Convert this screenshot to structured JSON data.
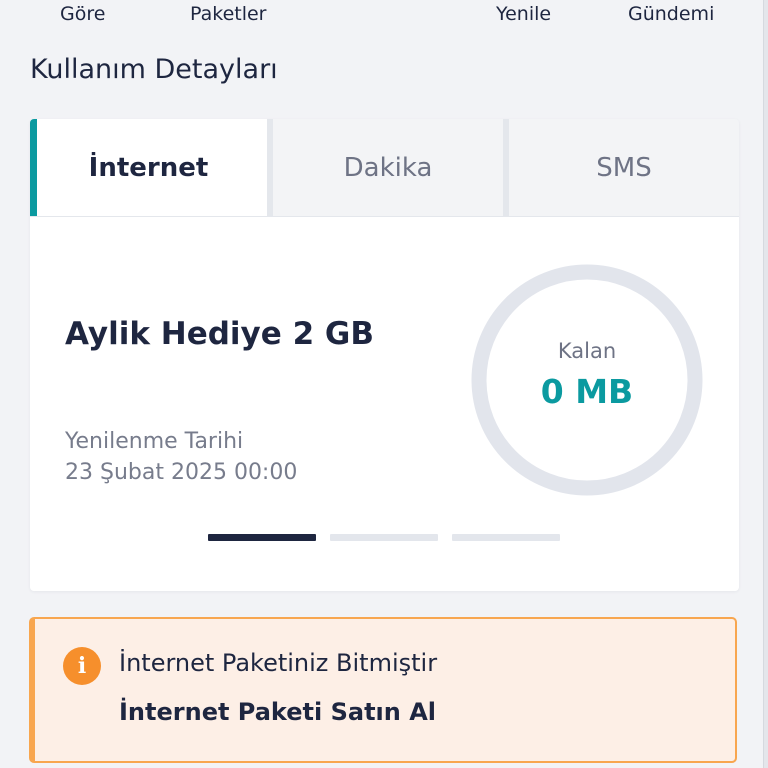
{
  "top_nav": {
    "items": [
      "Göre",
      "Paketler",
      "Yenile",
      "Gündemi"
    ]
  },
  "section_title": "Kullanım Detayları",
  "tabs": [
    {
      "label": "İnternet",
      "active": true
    },
    {
      "label": "Dakika",
      "active": false
    },
    {
      "label": "SMS",
      "active": false
    }
  ],
  "package": {
    "name": "Aylik Hediye 2 GB",
    "renewal_label": "Yenilenme Tarihi",
    "renewal_date": "23 Şubat 2025 00:00",
    "remaining_label": "Kalan",
    "remaining_value": "0 MB",
    "remaining_fraction": 0
  },
  "pager": {
    "count": 3,
    "active_index": 0
  },
  "alert": {
    "icon": "info-icon",
    "message": "İnternet Paketiniz Bitmiştir",
    "action_label": "İnternet Paketi Satın Al"
  },
  "colors": {
    "accent": "#0b9aa0",
    "warning": "#f8a64f",
    "warning_bg": "#fdefe6",
    "text": "#1e2640"
  }
}
